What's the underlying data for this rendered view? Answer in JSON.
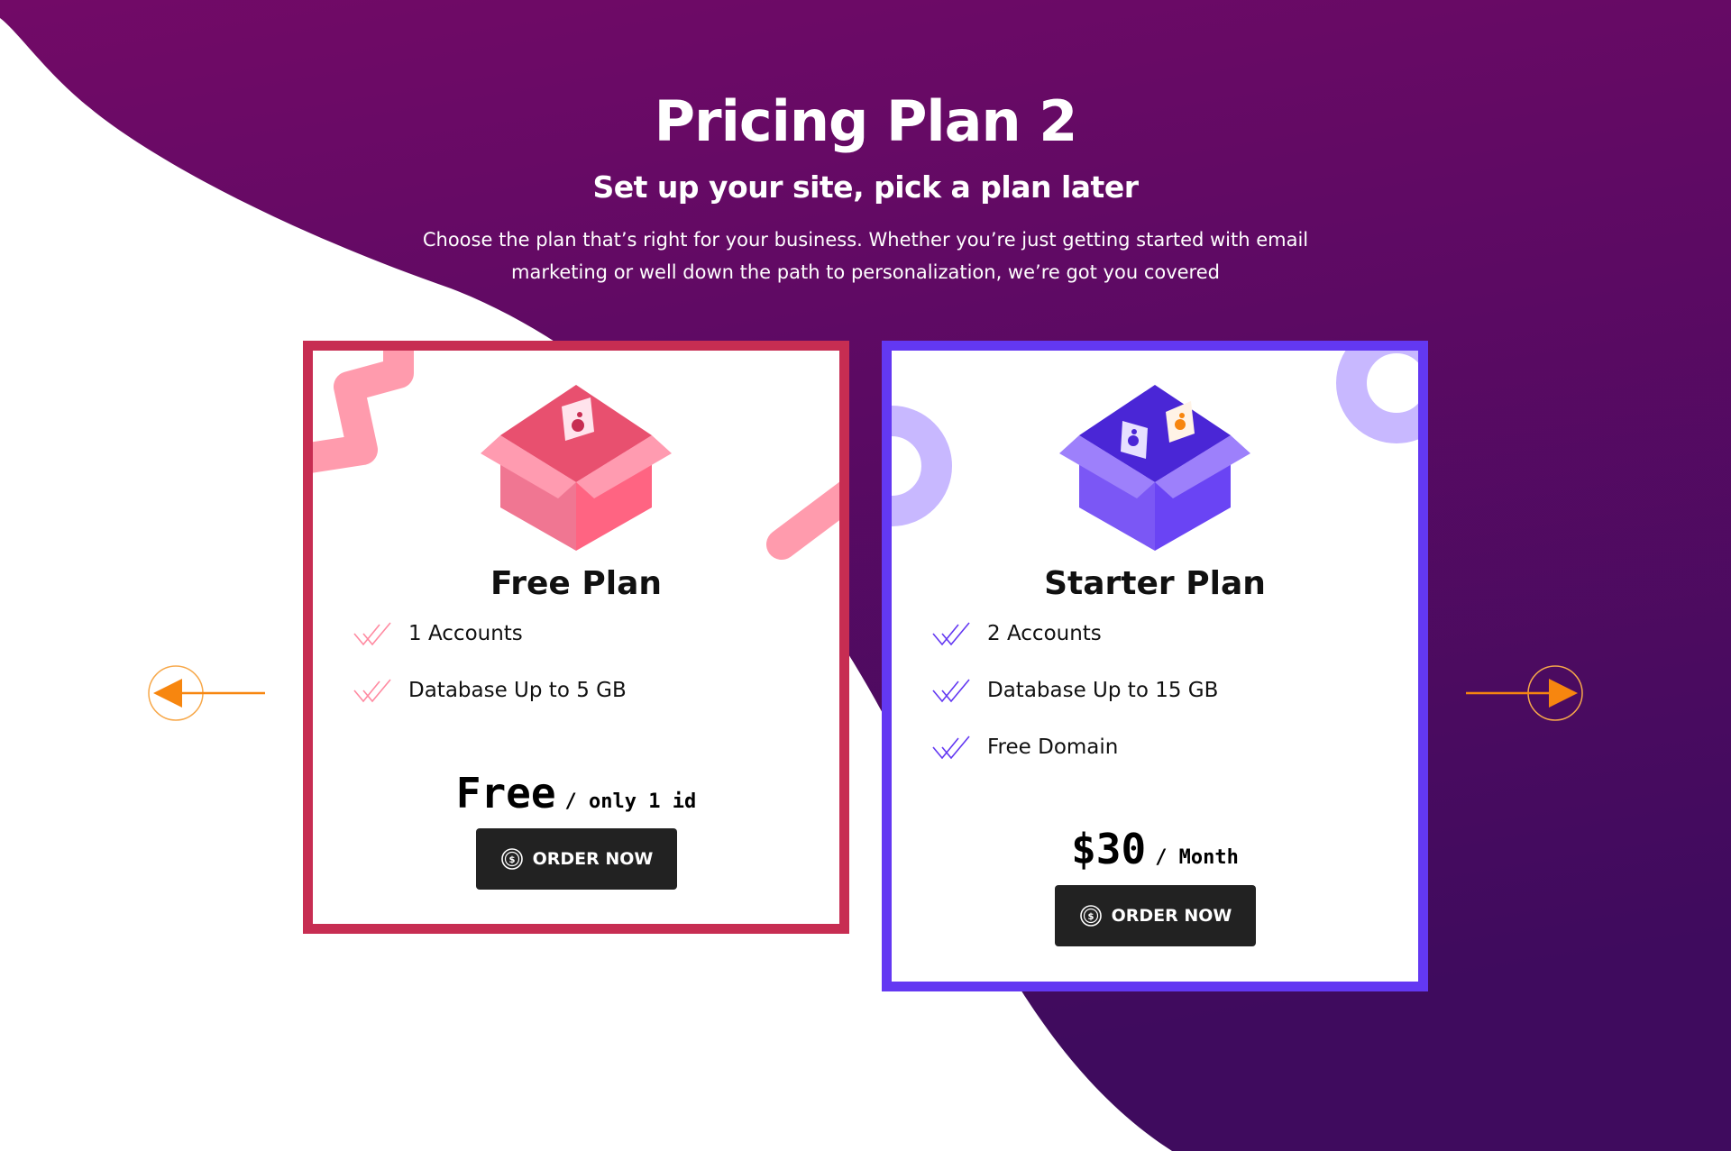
{
  "header": {
    "title": "Pricing Plan 2",
    "subtitle": "Set up your site, pick a plan later",
    "description": "Choose the plan that’s right for your business. Whether you’re just getting started with email marketing or well down the path to personalization, we’re got you covered"
  },
  "plans": [
    {
      "name": "Free Plan",
      "features": [
        "1 Accounts",
        "Database Up to 5 GB"
      ],
      "price": "Free",
      "period": "/ only 1 id",
      "button_label": "ORDER NOW",
      "accent_color": "#c72d52"
    },
    {
      "name": "Starter Plan",
      "features": [
        "2 Accounts",
        "Database Up to 15 GB",
        "Free Domain"
      ],
      "price": "$30",
      "period": "/ Month",
      "button_label": "ORDER NOW",
      "accent_color": "#6338f2"
    }
  ],
  "navigation": {
    "prev_icon": "arrow-left-icon",
    "next_icon": "arrow-right-icon",
    "arrow_color": "#f7860f"
  },
  "colors": {
    "background_gradient_top": "#6e0a68",
    "background_gradient_bottom": "#3d0b5e"
  }
}
